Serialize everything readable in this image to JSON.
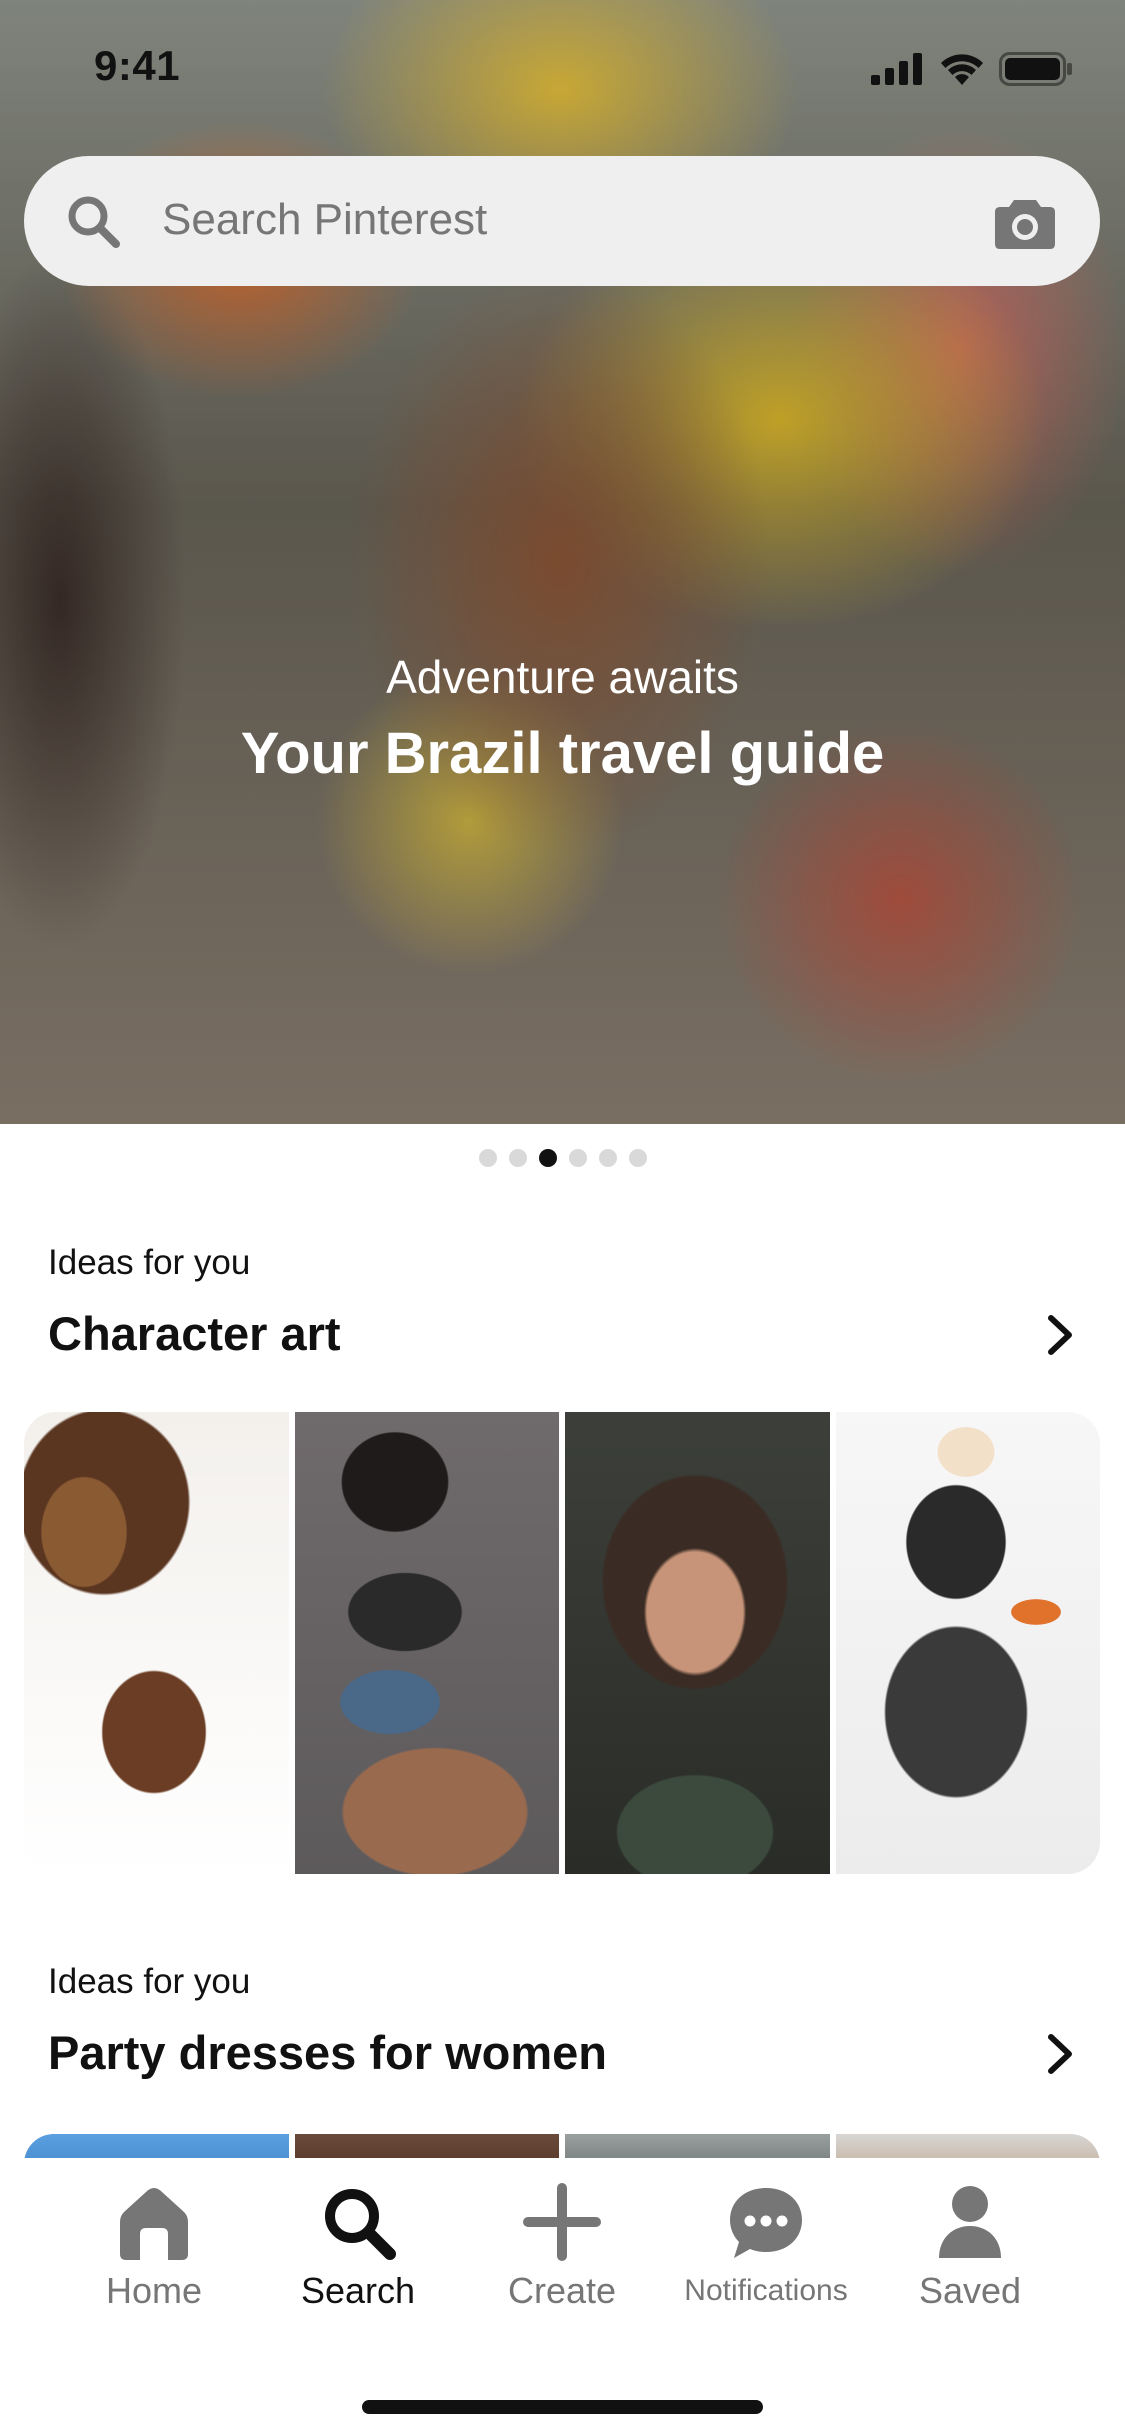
{
  "status_bar": {
    "time": "9:41"
  },
  "search": {
    "placeholder": "Search Pinterest"
  },
  "hero": {
    "kicker": "Adventure awaits",
    "title": "Your Brazil travel guide",
    "pages": 6,
    "active_page": 3
  },
  "sections": [
    {
      "kicker": "Ideas for you",
      "title": "Character art"
    },
    {
      "kicker": "Ideas for you",
      "title": "Party dresses for women"
    }
  ],
  "tabs": [
    {
      "label": "Home",
      "icon": "home-icon",
      "active": false
    },
    {
      "label": "Search",
      "icon": "search-icon",
      "active": true
    },
    {
      "label": "Create",
      "icon": "plus-icon",
      "active": false
    },
    {
      "label": "Notifications",
      "icon": "chat-bubble-icon",
      "active": false
    },
    {
      "label": "Saved",
      "icon": "profile-icon",
      "active": false
    }
  ],
  "colors": {
    "active": "#111111",
    "inactive": "#767676",
    "search_bg": "#efefef"
  }
}
